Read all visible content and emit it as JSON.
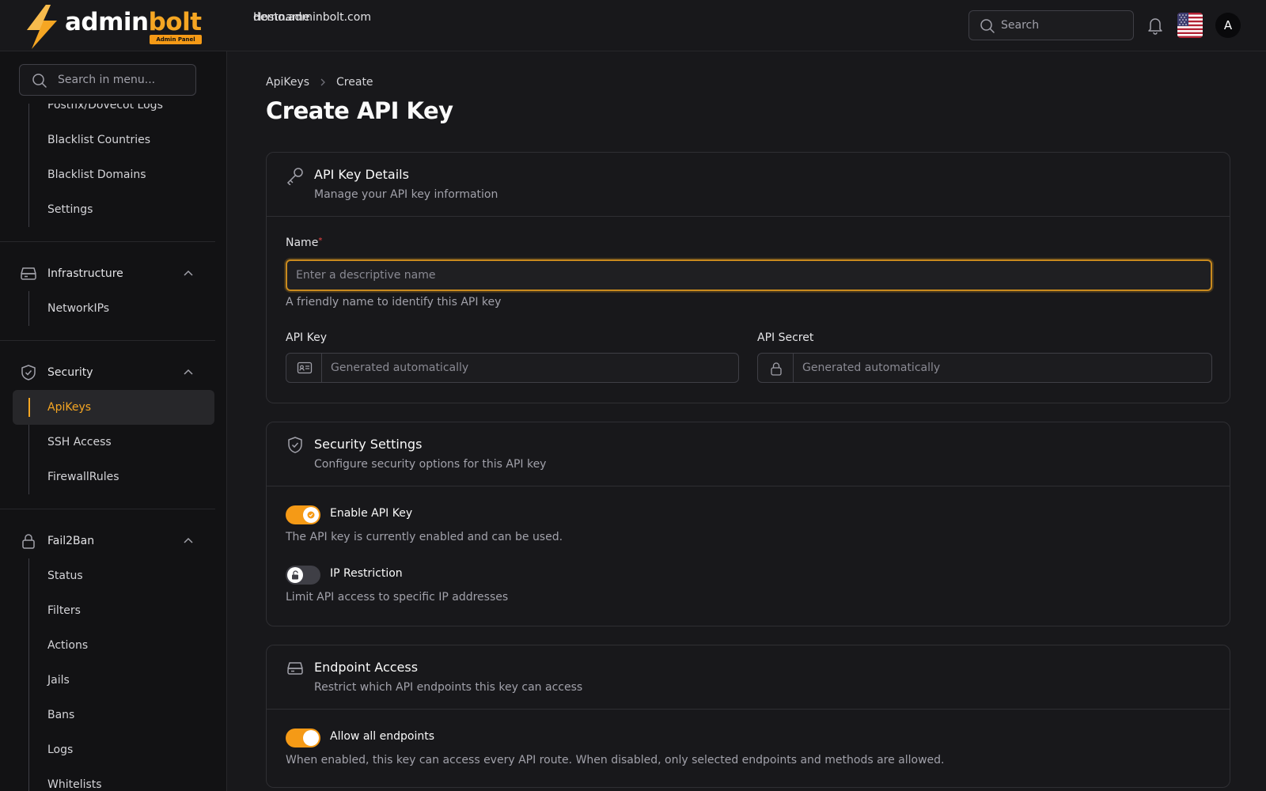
{
  "header": {
    "logo_text_main": "admin",
    "logo_text_accent": "bolt",
    "logo_badge": "Admin Panel",
    "hostname_label": "Hostname",
    "hostname_value": "demo.adminbolt.com",
    "search_placeholder": "Search",
    "avatar_initial": "A"
  },
  "sidebar": {
    "search_placeholder": "Search in menu...",
    "clipped_item": "Postfix/Dovecot Logs",
    "mail_items": [
      "Blacklist Countries",
      "Blacklist Domains",
      "Settings"
    ],
    "groups": [
      {
        "label": "Infrastructure",
        "icon": "server-icon",
        "items": [
          "NetworkIPs"
        ]
      },
      {
        "label": "Security",
        "icon": "shield-icon",
        "items": [
          "ApiKeys",
          "SSH Access",
          "FirewallRules"
        ],
        "active": "ApiKeys"
      },
      {
        "label": "Fail2Ban",
        "icon": "lock-icon",
        "items": [
          "Status",
          "Filters",
          "Actions",
          "Jails",
          "Bans",
          "Logs",
          "Whitelists"
        ]
      }
    ]
  },
  "breadcrumb": {
    "parent": "ApiKeys",
    "current": "Create"
  },
  "page_title": "Create API Key",
  "details_card": {
    "title": "API Key Details",
    "subtitle": "Manage your API key information",
    "name_label": "Name",
    "required_mark": "*",
    "name_placeholder": "Enter a descriptive name",
    "name_hint": "A friendly name to identify this API key",
    "api_key_label": "API Key",
    "api_key_placeholder": "Generated automatically",
    "api_secret_label": "API Secret",
    "api_secret_placeholder": "Generated automatically"
  },
  "security_card": {
    "title": "Security Settings",
    "subtitle": "Configure security options for this API key",
    "enable_label": "Enable API Key",
    "enable_hint": "The API key is currently enabled and can be used.",
    "enable_on": true,
    "ip_label": "IP Restriction",
    "ip_hint": "Limit API access to specific IP addresses",
    "ip_on": false
  },
  "endpoint_card": {
    "title": "Endpoint Access",
    "subtitle": "Restrict which API endpoints this key can access",
    "allow_label": "Allow all endpoints",
    "allow_hint": "When enabled, this key can access every API route. When disabled, only selected endpoints and methods are allowed.",
    "allow_on": true
  },
  "colors": {
    "accent": "#f59a16",
    "background": "#18181b",
    "sidebar": "#121214"
  }
}
